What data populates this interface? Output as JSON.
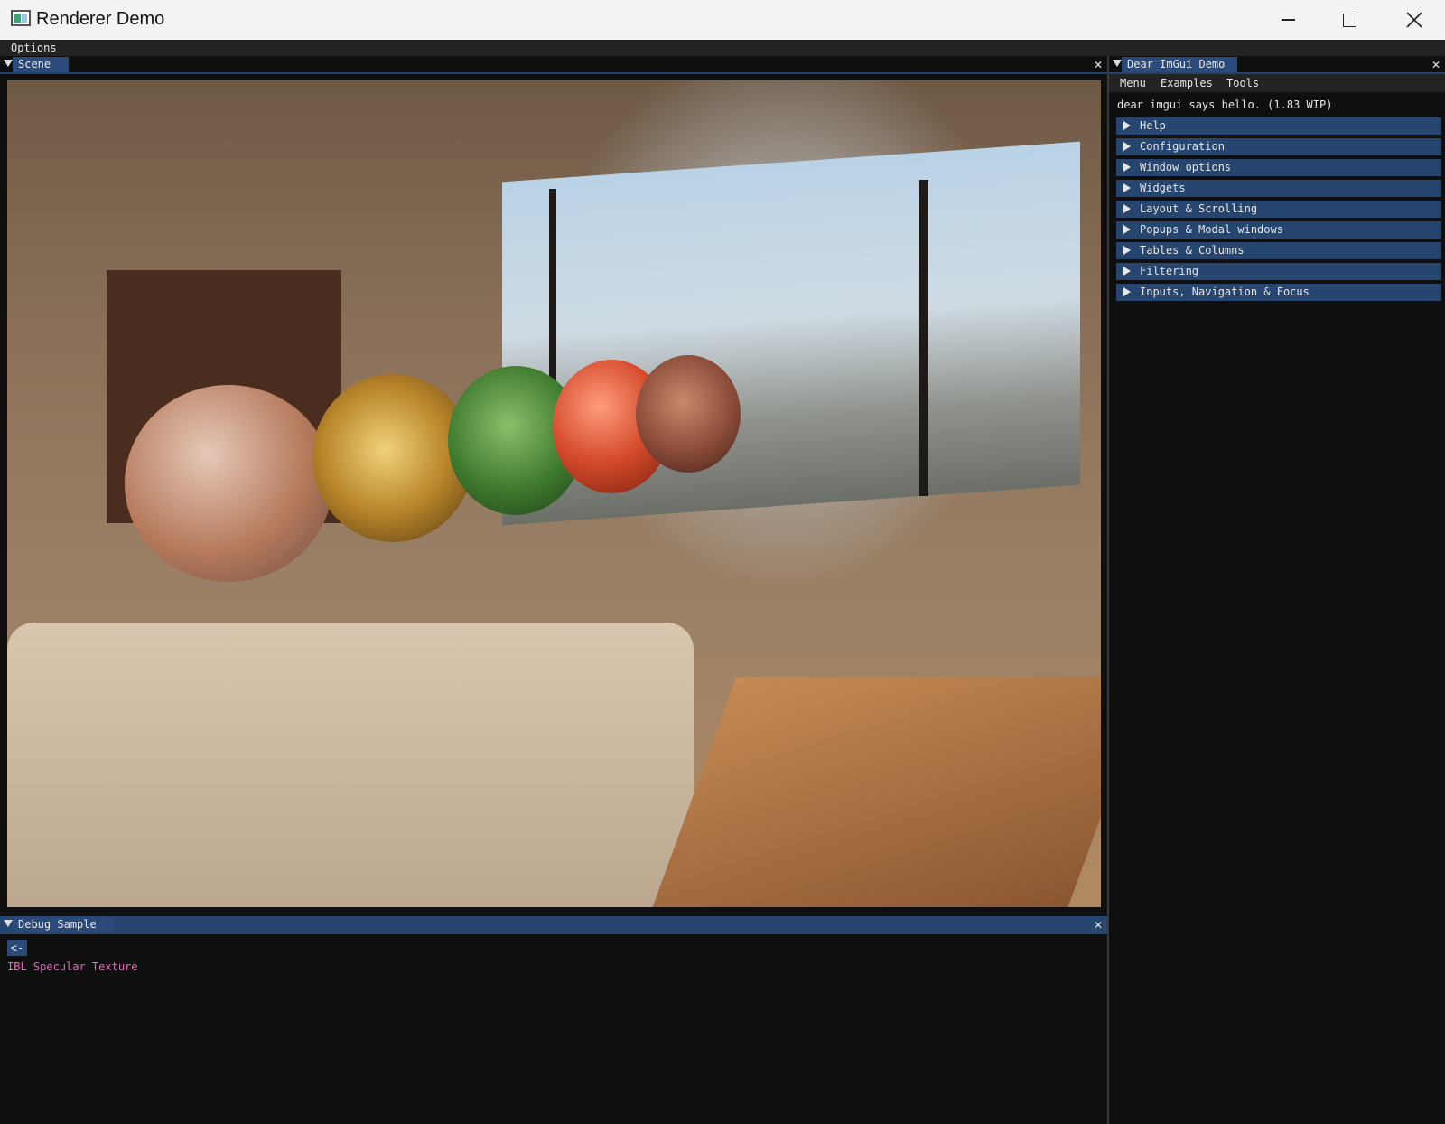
{
  "window": {
    "title": "Renderer Demo"
  },
  "main_menu": {
    "options": "Options"
  },
  "scene": {
    "tab_label": "Scene",
    "close_glyph": "✕"
  },
  "debug": {
    "tab_label": "Debug Sample",
    "back_label": "<-",
    "texture_label": "IBL Specular Texture",
    "close_glyph": "✕"
  },
  "demo": {
    "tab_label": "Dear ImGui Demo",
    "close_glyph": "✕",
    "menu": [
      "Menu",
      "Examples",
      "Tools"
    ],
    "hello": "dear imgui says hello. (1.83 WIP)",
    "headers": [
      "Help",
      "Configuration",
      "Window options",
      "Widgets",
      "Layout & Scrolling",
      "Popups & Modal windows",
      "Tables & Columns",
      "Filtering",
      "Inputs, Navigation & Focus"
    ]
  },
  "colors": {
    "tab_active": "#294a7a",
    "header_bg": "#26466f",
    "debug_text": "#e86ab8"
  }
}
